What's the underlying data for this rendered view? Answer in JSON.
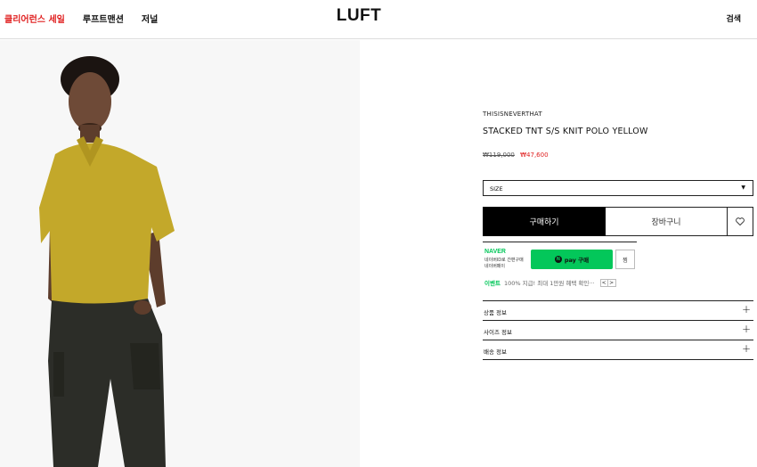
{
  "header": {
    "nav": [
      "클리어런스 세일",
      "루프트맨션",
      "저널"
    ],
    "logo": "LUFT",
    "search_label": "검색"
  },
  "product": {
    "brand": "THISISNEVERTHAT",
    "name": "STACKED TNT S/S KNIT POLO YELLOW",
    "original_price": "₩119,000",
    "sale_price": "₩47,600",
    "size_label": "SIZE"
  },
  "actions": {
    "buy_label": "구매하기",
    "cart_label": "장바구니"
  },
  "npay": {
    "brand": "NAVER",
    "sub1": "네이버ID로 간편구매",
    "sub2": "네이버페이",
    "logo_letter": "N",
    "button_label": "pay 구매",
    "zzim_label": "찜",
    "event_tag": "이벤트",
    "event_text": "100% 지급! 최대 1만원 혜택 확인···",
    "prev": "<",
    "next": ">"
  },
  "accordion": [
    "상품 정보",
    "사이즈 정보",
    "배송 정보"
  ],
  "colors": {
    "sale": "#e02020",
    "naver_green": "#03c75a",
    "shirt_yellow": "#c3a82a"
  }
}
